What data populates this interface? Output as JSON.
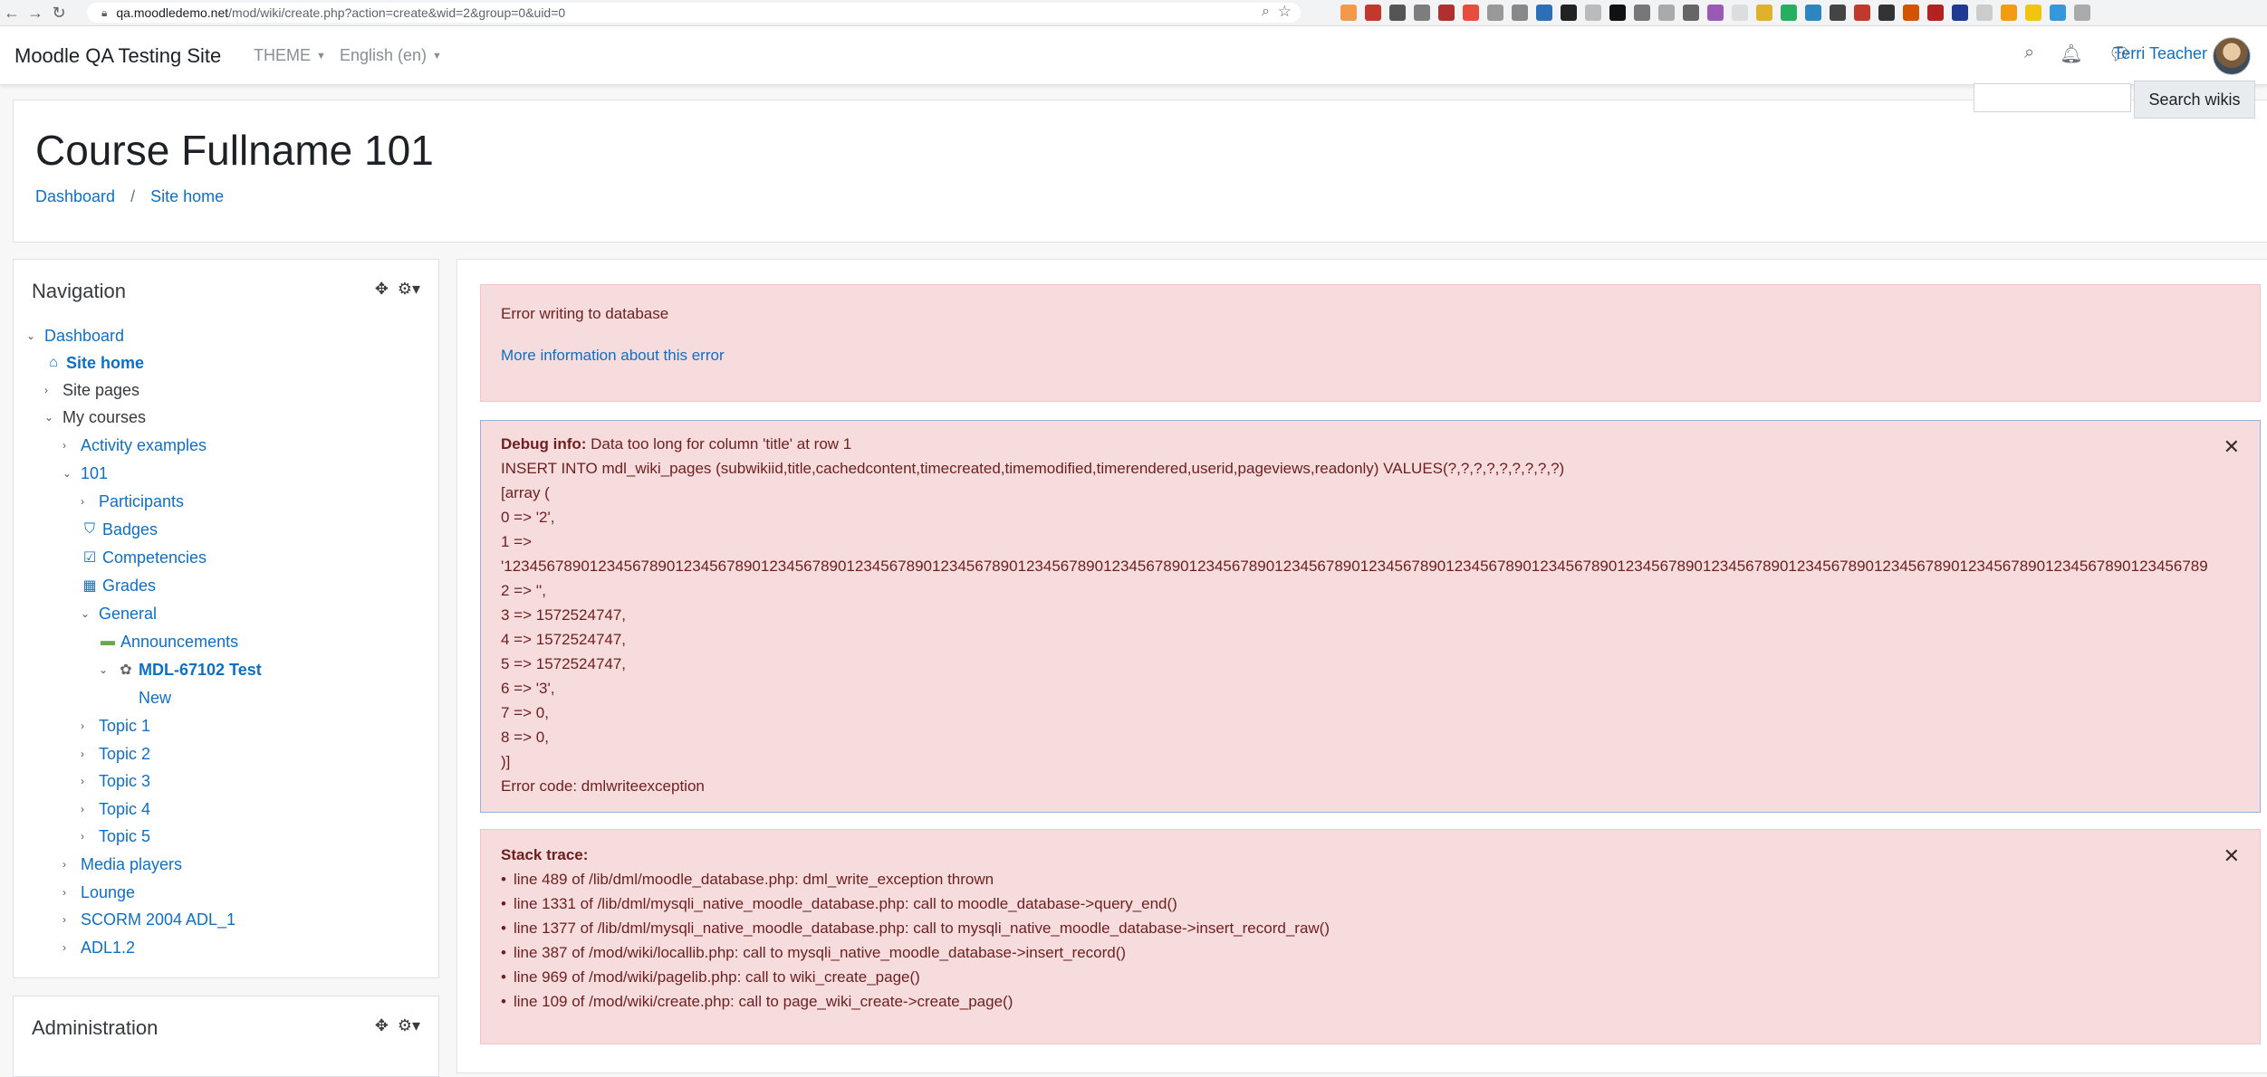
{
  "browser": {
    "url_host": "qa.moodledemo.net",
    "url_path": "/mod/wiki/create.php?action=create&wid=2&group=0&uid=0"
  },
  "navbar": {
    "site_name": "Moodle QA Testing Site",
    "theme_label": "THEME",
    "language_label": "English (en)",
    "user_name": "Terri Teacher"
  },
  "header": {
    "title": "Course Fullname 101",
    "breadcrumb": [
      "Dashboard",
      "Site home"
    ],
    "search_button": "Search wikis"
  },
  "navigation": {
    "title": "Navigation",
    "items": [
      {
        "label": "Dashboard",
        "toggle": "⌄",
        "icon": ""
      },
      {
        "label": "Site home",
        "toggle": "",
        "icon": "⌂"
      },
      {
        "label": "Site pages",
        "toggle": "›",
        "icon": ""
      },
      {
        "label": "My courses",
        "toggle": "⌄",
        "icon": ""
      },
      {
        "label": "Activity examples",
        "toggle": "›",
        "icon": ""
      },
      {
        "label": "101",
        "toggle": "⌄",
        "icon": ""
      },
      {
        "label": "Participants",
        "toggle": "›",
        "icon": ""
      },
      {
        "label": "Badges",
        "toggle": "",
        "icon": "⛉"
      },
      {
        "label": "Competencies",
        "toggle": "",
        "icon": "☑"
      },
      {
        "label": "Grades",
        "toggle": "",
        "icon": "▦"
      },
      {
        "label": "General",
        "toggle": "⌄",
        "icon": ""
      },
      {
        "label": "Announcements",
        "toggle": "",
        "icon": "▬"
      },
      {
        "label": "MDL-67102 Test",
        "toggle": "⌄",
        "icon": "✿"
      },
      {
        "label": "New",
        "toggle": "",
        "icon": ""
      },
      {
        "label": "Topic 1",
        "toggle": "›",
        "icon": ""
      },
      {
        "label": "Topic 2",
        "toggle": "›",
        "icon": ""
      },
      {
        "label": "Topic 3",
        "toggle": "›",
        "icon": ""
      },
      {
        "label": "Topic 4",
        "toggle": "›",
        "icon": ""
      },
      {
        "label": "Topic 5",
        "toggle": "›",
        "icon": ""
      },
      {
        "label": "Media players",
        "toggle": "›",
        "icon": ""
      },
      {
        "label": "Lounge",
        "toggle": "›",
        "icon": ""
      },
      {
        "label": "SCORM 2004 ADL_1",
        "toggle": "›",
        "icon": ""
      },
      {
        "label": "ADL1.2",
        "toggle": "›",
        "icon": ""
      }
    ]
  },
  "administration": {
    "title": "Administration"
  },
  "error_alert": {
    "message": "Error writing to database",
    "link": "More information about this error"
  },
  "debug_alert": {
    "label": "Debug info:",
    "message": "Data too long for column 'title' at row 1",
    "lines": [
      "INSERT INTO mdl_wiki_pages (subwikiid,title,cachedcontent,timecreated,timemodified,timerendered,userid,pageviews,readonly) VALUES(?,?,?,?,?,?,?,?,?)",
      "[array (",
      "0 => '2',",
      "1 =>",
      "'1234567890123456789012345678901234567890123456789012345678901234567890123456789012345678901234567890123456789012345678901234567890123456789012345678901234567890123456789012345678901234567890123456789",
      "2 => '',",
      "3 => 1572524747,",
      "4 => 1572524747,",
      "5 => 1572524747,",
      "6 => '3',",
      "7 => 0,",
      "8 => 0,",
      ")]",
      "Error code: dmlwriteexception"
    ]
  },
  "stack_alert": {
    "title": "Stack trace:",
    "lines": [
      "line 489 of /lib/dml/moodle_database.php: dml_write_exception thrown",
      "line 1331 of /lib/dml/mysqli_native_moodle_database.php: call to moodle_database->query_end()",
      "line 1377 of /lib/dml/mysqli_native_moodle_database.php: call to mysqli_native_moodle_database->insert_record_raw()",
      "line 387 of /mod/wiki/locallib.php: call to mysqli_native_moodle_database->insert_record()",
      "line 969 of /mod/wiki/pagelib.php: call to wiki_create_page()",
      "line 109 of /mod/wiki/create.php: call to page_wiki_create->create_page()"
    ]
  },
  "colors": {
    "link": "#0f6fc5",
    "alert_bg": "#f6dcdc",
    "alert_text": "#6e1f1f"
  }
}
